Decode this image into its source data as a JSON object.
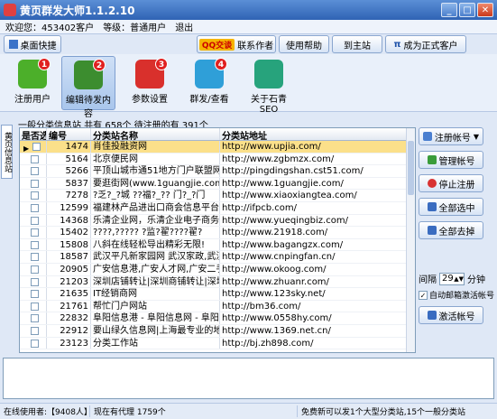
{
  "window": {
    "title": "黄页群发大师1.1.2.10"
  },
  "infobar": {
    "user_label": "欢迎您：453402客户",
    "level_label": "等级：普通用户",
    "logout": "退出"
  },
  "toolbar": {
    "desktop_label": "桌面快捷",
    "qq_badge": "QQ交谈",
    "contact_author": "联系作者",
    "help": "使用帮助",
    "home_site": "到主站",
    "upgrade": "成为正式客户"
  },
  "tools": [
    {
      "label": "注册用户",
      "badge": "1",
      "color": "#4caf2a"
    },
    {
      "label": "编辑待发内容",
      "badge": "2",
      "color": "#3c8d2f"
    },
    {
      "label": "参数设置",
      "badge": "3",
      "color": "#d9302c"
    },
    {
      "label": "群发/查看",
      "badge": "4",
      "color": "#2f9fd8"
    },
    {
      "label": "关于石青SEO",
      "badge": "",
      "color": "#27a37c"
    }
  ],
  "summary": "一般分类信息站 共有 658个 待注册的有 391个",
  "sidetab": "黄页信息站",
  "grid": {
    "headers": [
      "是否选",
      "编号",
      "分类站名称",
      "分类站地址"
    ],
    "rows": [
      {
        "id": "1474",
        "name": "肖佳投融资网",
        "url": "http://www.upjia.com/",
        "selected": true
      },
      {
        "id": "5164",
        "name": "北京便民网",
        "url": "http://www.zgbmzx.com/"
      },
      {
        "id": "5266",
        "name": "平顶山城市通51地方门户联盟网 - 平顶",
        "url": "http://pingdingshan.cst51.com/"
      },
      {
        "id": "5837",
        "name": "要逛街网(www.1guangjie.com) - 逛",
        "url": "http://www.1guangjie.com/"
      },
      {
        "id": "7278",
        "name": "?乏?_?城 ??福?_?? 门?_?门",
        "url": "http://www.xiaoxiangtea.com/"
      },
      {
        "id": "12599",
        "name": "福建林产品进出口商会信息平台",
        "url": "http://ifpcb.com/"
      },
      {
        "id": "14368",
        "name": "乐清企业网，乐清企业电子商务平台",
        "url": "http://www.yueqingbiz.com/"
      },
      {
        "id": "15402",
        "name": "????,?????  ?监?翟????翟?",
        "url": "http://www.21918.com/"
      },
      {
        "id": "15808",
        "name": "八斜在线轻松导出精彩无限!",
        "url": "http://www.bagangzx.com/"
      },
      {
        "id": "18587",
        "name": "武汉平凡新家园网 武汉家政,武汉保洁",
        "url": "http://www.cnpingfan.cn/"
      },
      {
        "id": "20905",
        "name": "广安信息港,广安人才网,广安二手",
        "url": "http://www.okoog.com/"
      },
      {
        "id": "21203",
        "name": "深圳店铺转让|深圳商铺转让|深圳铺",
        "url": "http://www.zhuanr.com/"
      },
      {
        "id": "21635",
        "name": "IT经销商网",
        "url": "http://www.123sky.net/"
      },
      {
        "id": "21761",
        "name": "帮忙门户网站",
        "url": "http://bm36.com/"
      },
      {
        "id": "22832",
        "name": "阜阳信息港 - 阜阳信息网 - 阜阳分类",
        "url": "http://www.0558hy.com/"
      },
      {
        "id": "22912",
        "name": "要山绿久信息网|上海最专业的地方信息",
        "url": "http://www.1369.net.cn/"
      },
      {
        "id": "23123",
        "name": "分类工作站",
        "url": "http://bj.zh898.com/"
      }
    ]
  },
  "right_panel": {
    "register_btn": "注册帐号",
    "manage_btn": "管理帐号",
    "stop_btn": "停止注册",
    "select_all": "全部选中",
    "deselect_all": "全部去掉",
    "interval_label": "间隔",
    "interval_value": "29",
    "interval_unit": "分钟",
    "auto_email_label": "自动邮箱激活帐号",
    "activate_btn": "激活帐号"
  },
  "statusbar": {
    "online": "在线使用者:【9408人】",
    "agents": "现在有代理 1759个",
    "notice": "免费新可以发1个大型分类站,15个一般分类站"
  }
}
